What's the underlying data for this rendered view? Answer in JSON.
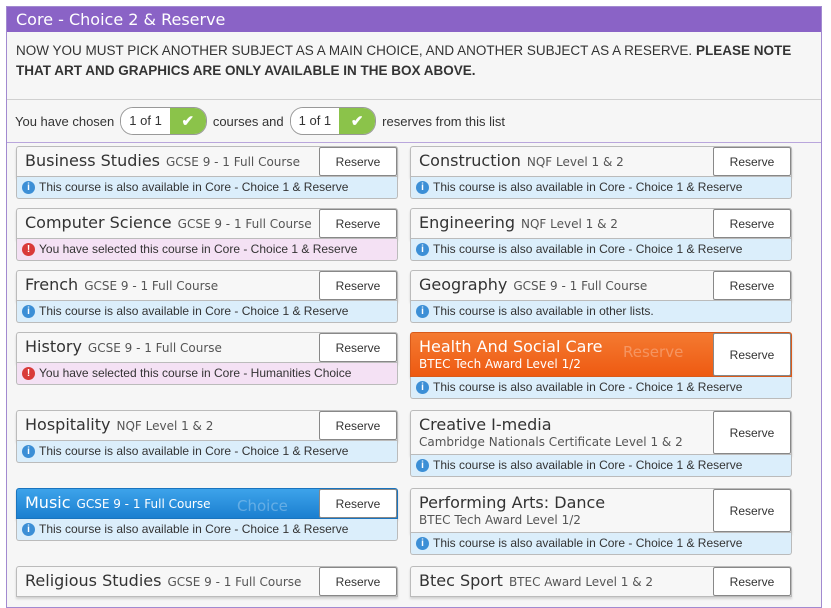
{
  "panel": {
    "title": "Core - Choice 2 & Reserve",
    "notice_plain": "NOW YOU MUST PICK ANOTHER SUBJECT AS A MAIN CHOICE, AND ANOTHER SUBJECT AS A RESERVE.",
    "notice_bold": "PLEASE NOTE THAT ART AND GRAPHICS ARE ONLY AVAILABLE IN THE BOX ABOVE."
  },
  "chosen": {
    "prefix": "You have chosen",
    "courses_count": "1 of 1",
    "middle": "courses and",
    "reserves_count": "1 of 1",
    "suffix": "reserves from this list"
  },
  "reserve_label": "Reserve",
  "courses": [
    {
      "name": "Business Studies",
      "qual": "GCSE 9 - 1 Full Course",
      "info": "This course is also available in Core - Choice 1 & Reserve",
      "type": "info"
    },
    {
      "name": "Construction",
      "qual": "NQF Level 1 & 2",
      "info": "This course is also available in Core - Choice 1 & Reserve",
      "type": "info"
    },
    {
      "name": "Computer Science",
      "qual": "GCSE 9 - 1 Full Course",
      "info": "You have selected this course in Core - Choice 1 & Reserve",
      "type": "warn"
    },
    {
      "name": "Engineering",
      "qual": "NQF Level 1 & 2",
      "info": "This course is also available in Core - Choice 1 & Reserve",
      "type": "info"
    },
    {
      "name": "French",
      "qual": "GCSE 9 - 1 Full Course",
      "info": "This course is also available in Core - Choice 1 & Reserve",
      "type": "info"
    },
    {
      "name": "Geography",
      "qual": "GCSE 9 - 1 Full Course",
      "info": "This course is also available in other lists.",
      "type": "info"
    },
    {
      "name": "History",
      "qual": "GCSE 9 - 1 Full Course",
      "info": "You have selected this course in Core - Humanities Choice",
      "type": "warn"
    },
    {
      "name": "Health And Social Care",
      "qual": "BTEC Tech Award Level 1/2",
      "info": "This course is also available in Core - Choice 1 & Reserve",
      "type": "info",
      "state": "reserve-selected",
      "ghost": "Reserve"
    },
    {
      "name": "Hospitality",
      "qual": "NQF Level 1 & 2",
      "info": "This course is also available in Core - Choice 1 & Reserve",
      "type": "info"
    },
    {
      "name": "Creative I-media",
      "qual": "Cambridge Nationals Certificate Level 1 & 2",
      "info": "This course is also available in Core - Choice 1 & Reserve",
      "type": "info"
    },
    {
      "name": "Music",
      "qual": "GCSE 9 - 1 Full Course",
      "info": "This course is also available in Core - Choice 1 & Reserve",
      "type": "info",
      "state": "choice-selected",
      "ghost": "Choice"
    },
    {
      "name": "Performing Arts: Dance",
      "qual": "BTEC Tech Award Level 1/2",
      "info": "This course is also available in Core - Choice 1 & Reserve",
      "type": "info"
    },
    {
      "name": "Religious Studies",
      "qual": "GCSE 9 - 1 Full Course",
      "info": "",
      "type": "info"
    },
    {
      "name": "Btec Sport",
      "qual": "BTEC Award Level 1 & 2",
      "info": "",
      "type": "info"
    }
  ],
  "colors": {
    "header": "#8a63c6",
    "selected_reserve": "#ee5a12",
    "selected_choice": "#1b7fd0",
    "check": "#8bc34a"
  }
}
